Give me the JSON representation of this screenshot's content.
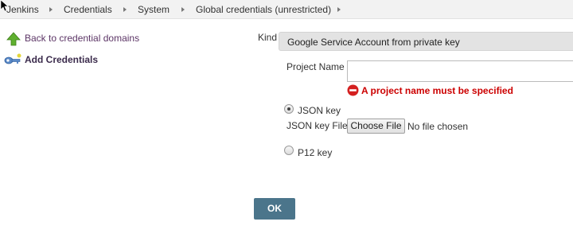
{
  "breadcrumb": {
    "items": [
      {
        "label": "Jenkins"
      },
      {
        "label": "Credentials"
      },
      {
        "label": "System"
      },
      {
        "label": "Global credentials (unrestricted)"
      }
    ]
  },
  "sidebar": {
    "items": [
      {
        "label": "Back to credential domains",
        "icon": "up-arrow-icon"
      },
      {
        "label": "Add Credentials",
        "icon": "key-icon"
      }
    ]
  },
  "form": {
    "kind_label": "Kind",
    "kind_value": "Google Service Account from private key",
    "project_name_label": "Project Name",
    "project_name_value": "",
    "project_name_error": "A project name must be specified",
    "key_options": [
      {
        "label": "JSON key",
        "selected": true
      },
      {
        "label": "P12 key",
        "selected": false
      }
    ],
    "json_key_file_label": "JSON key File",
    "choose_file_label": "Choose File",
    "file_status": "No file chosen",
    "ok_label": "OK"
  },
  "colors": {
    "ok_button": "#4b758b",
    "error": "#cc0000",
    "link": "#5c3566",
    "breadcrumb_bg": "#f2f2f2",
    "kind_bg": "#e3e3e3"
  }
}
